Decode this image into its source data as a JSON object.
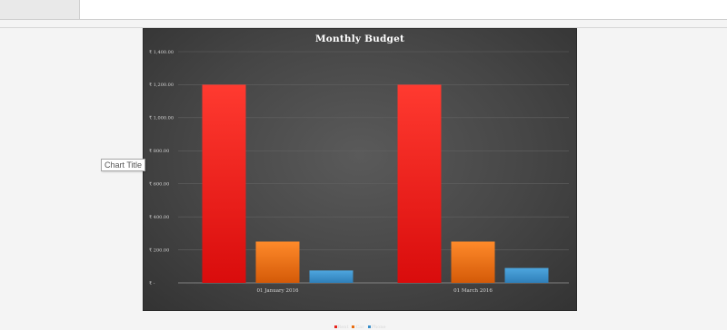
{
  "tooltip": {
    "text": "Chart Title"
  },
  "chart_data": {
    "type": "bar",
    "title": "Monthly Budget",
    "categories": [
      "01 January 2016",
      "01 March 2016"
    ],
    "series": [
      {
        "name": "Rent",
        "values": [
          1200,
          1200
        ],
        "color": "#e8241c"
      },
      {
        "name": "Car",
        "values": [
          250,
          250
        ],
        "color": "#e86e12"
      },
      {
        "name": "Phone",
        "values": [
          75,
          90
        ],
        "color": "#3b8fc9"
      }
    ],
    "ylim": [
      0,
      1400
    ],
    "yticks": [
      0,
      200,
      400,
      600,
      800,
      1000,
      1200,
      1400
    ],
    "ytick_labels": [
      "₹ -",
      "₹ 200.00",
      "₹ 400.00",
      "₹ 600.00",
      "₹ 800.00",
      "₹ 1,000.00",
      "₹ 1,200.00",
      "₹ 1,400.00"
    ],
    "grid": true,
    "legend_position": "bottom"
  }
}
